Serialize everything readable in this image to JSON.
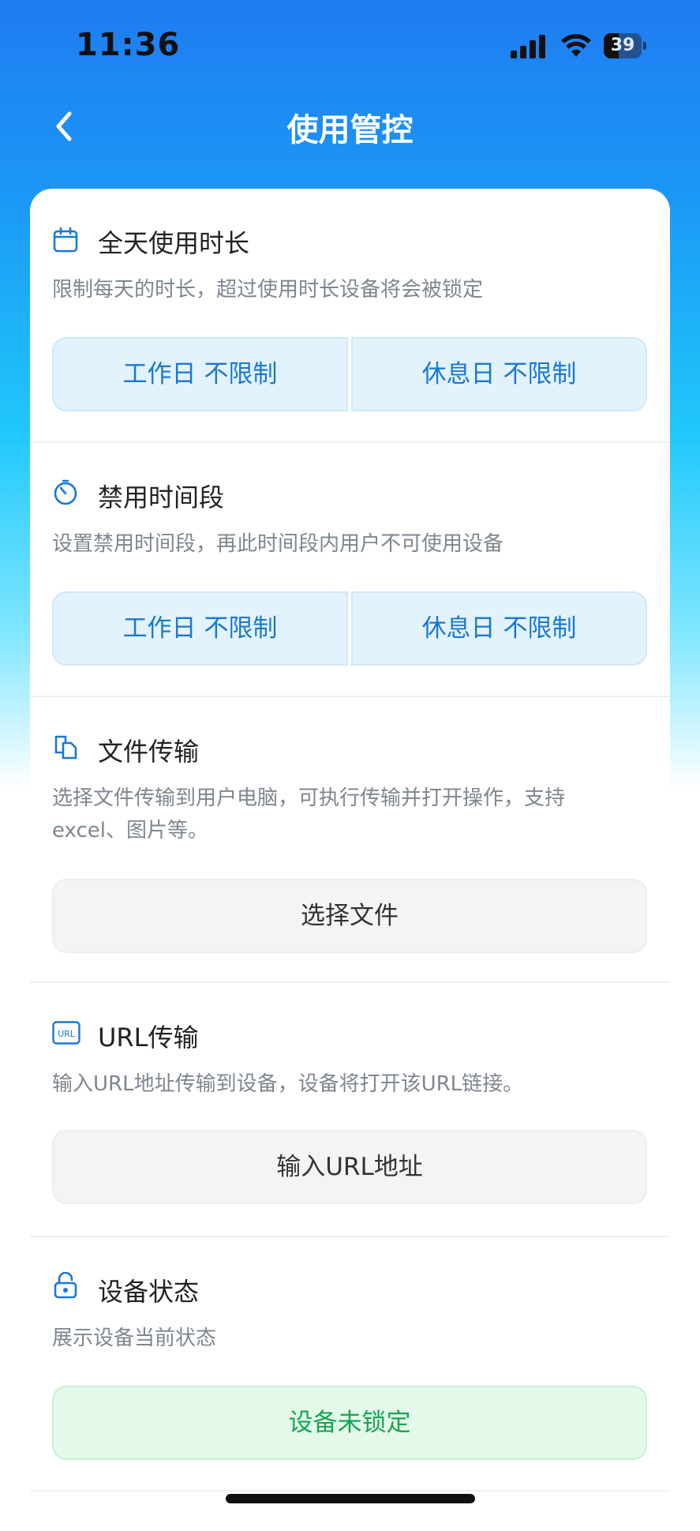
{
  "status_bar": {
    "time": "11:36",
    "battery_level": "39",
    "battery_fraction": 0.39
  },
  "header": {
    "title": "使用管控",
    "back_icon": "chevron-left-icon"
  },
  "sections": [
    {
      "icon": "calendar-icon",
      "title": "全天使用时长",
      "description": "限制每天的时长，超过使用时长设备将会被锁定",
      "workday_label": "工作日 不限制",
      "restday_label": "休息日 不限制"
    },
    {
      "icon": "timer-icon",
      "title": "禁用时间段",
      "description": "设置禁用时间段，再此时间段内用户不可使用设备",
      "workday_label": "工作日 不限制",
      "restday_label": "休息日 不限制"
    },
    {
      "icon": "file-copy-icon",
      "title": "文件传输",
      "description_line1": "选择文件传输到用户电脑，可执行传输并打开操作，支持",
      "description_line2": "excel、图片等。",
      "button_label": "选择文件"
    },
    {
      "icon": "url-icon",
      "icon_text": "URL",
      "title": "URL传输",
      "description": "输入URL地址传输到设备，设备将打开该URL链接。",
      "button_label": "输入URL地址"
    },
    {
      "icon": "unlock-icon",
      "title": "设备状态",
      "description": "展示设备当前状态",
      "status_label": "设备未锁定"
    }
  ],
  "colors": {
    "accent_blue": "#1a78d2",
    "status_green": "#19a453",
    "header_gradient_top": "#1f7cf2"
  }
}
